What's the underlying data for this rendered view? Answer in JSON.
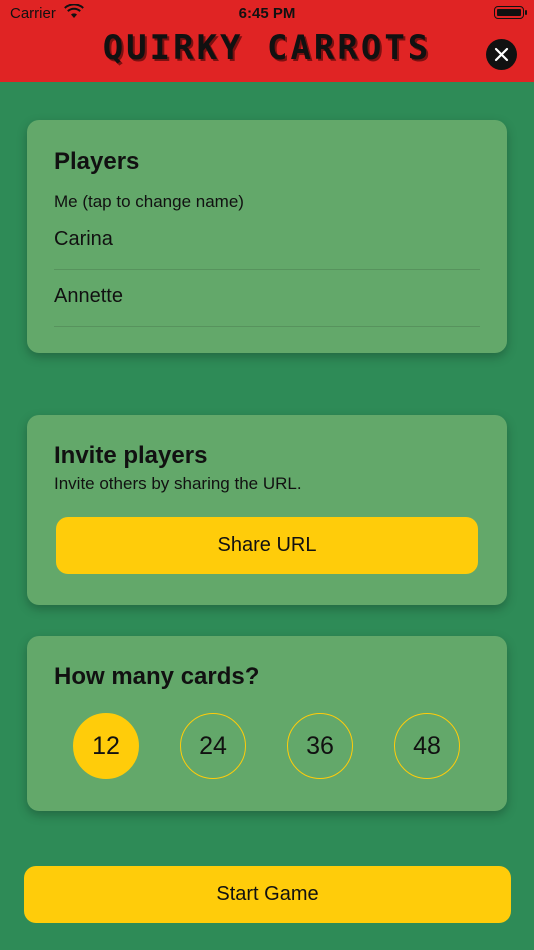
{
  "status_bar": {
    "carrier": "Carrier",
    "time": "6:45 PM"
  },
  "app": {
    "title": "QUIRKY CARROTS"
  },
  "players": {
    "heading": "Players",
    "me_hint": "Me (tap to change name)",
    "names": [
      "Carina",
      "Annette"
    ]
  },
  "invite": {
    "heading": "Invite players",
    "description": "Invite others by sharing the URL.",
    "share_label": "Share URL"
  },
  "cards": {
    "heading": "How many cards?",
    "options": [
      "12",
      "24",
      "36",
      "48"
    ],
    "selected": "12"
  },
  "start_label": "Start Game",
  "colors": {
    "header": "#e02424",
    "background": "#2e8b57",
    "card": "#63a86a",
    "accent": "#ffcc0a"
  }
}
